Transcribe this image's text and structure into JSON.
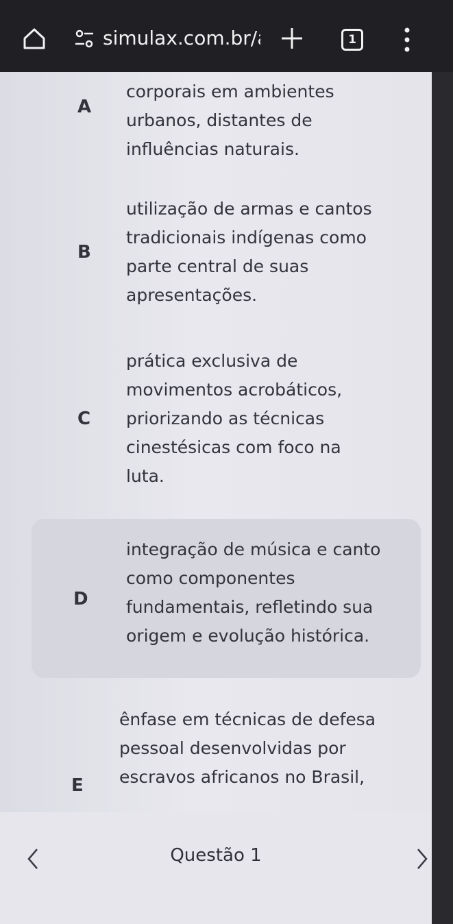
{
  "browser": {
    "url": "simulax.com.br/a",
    "tab_count": "1"
  },
  "options": [
    {
      "letter": "A",
      "lines": [
        "corporais em ambientes",
        "urbanos, distantes de",
        "influências naturais."
      ]
    },
    {
      "letter": "B",
      "lines": [
        "utilização de armas e cantos",
        "tradicionais indígenas como",
        "parte central de suas",
        "apresentações."
      ]
    },
    {
      "letter": "C",
      "lines": [
        "prática exclusiva de",
        "movimentos acrobáticos,",
        "priorizando as técnicas",
        "cinestésicas com foco na",
        "luta."
      ]
    },
    {
      "letter": "D",
      "lines": [
        "integração de música e canto",
        "como componentes",
        "fundamentais, refletindo sua",
        "origem e evolução histórica."
      ]
    },
    {
      "letter": "E",
      "lines": [
        "ênfase em técnicas de defesa",
        "pessoal desenvolvidas por",
        "escravos africanos no Brasil,"
      ]
    }
  ],
  "footer": {
    "title": "Questão 1"
  },
  "colors": {
    "selected_bg": "#d6d6de",
    "toolbar_bg": "#1f1f24"
  }
}
